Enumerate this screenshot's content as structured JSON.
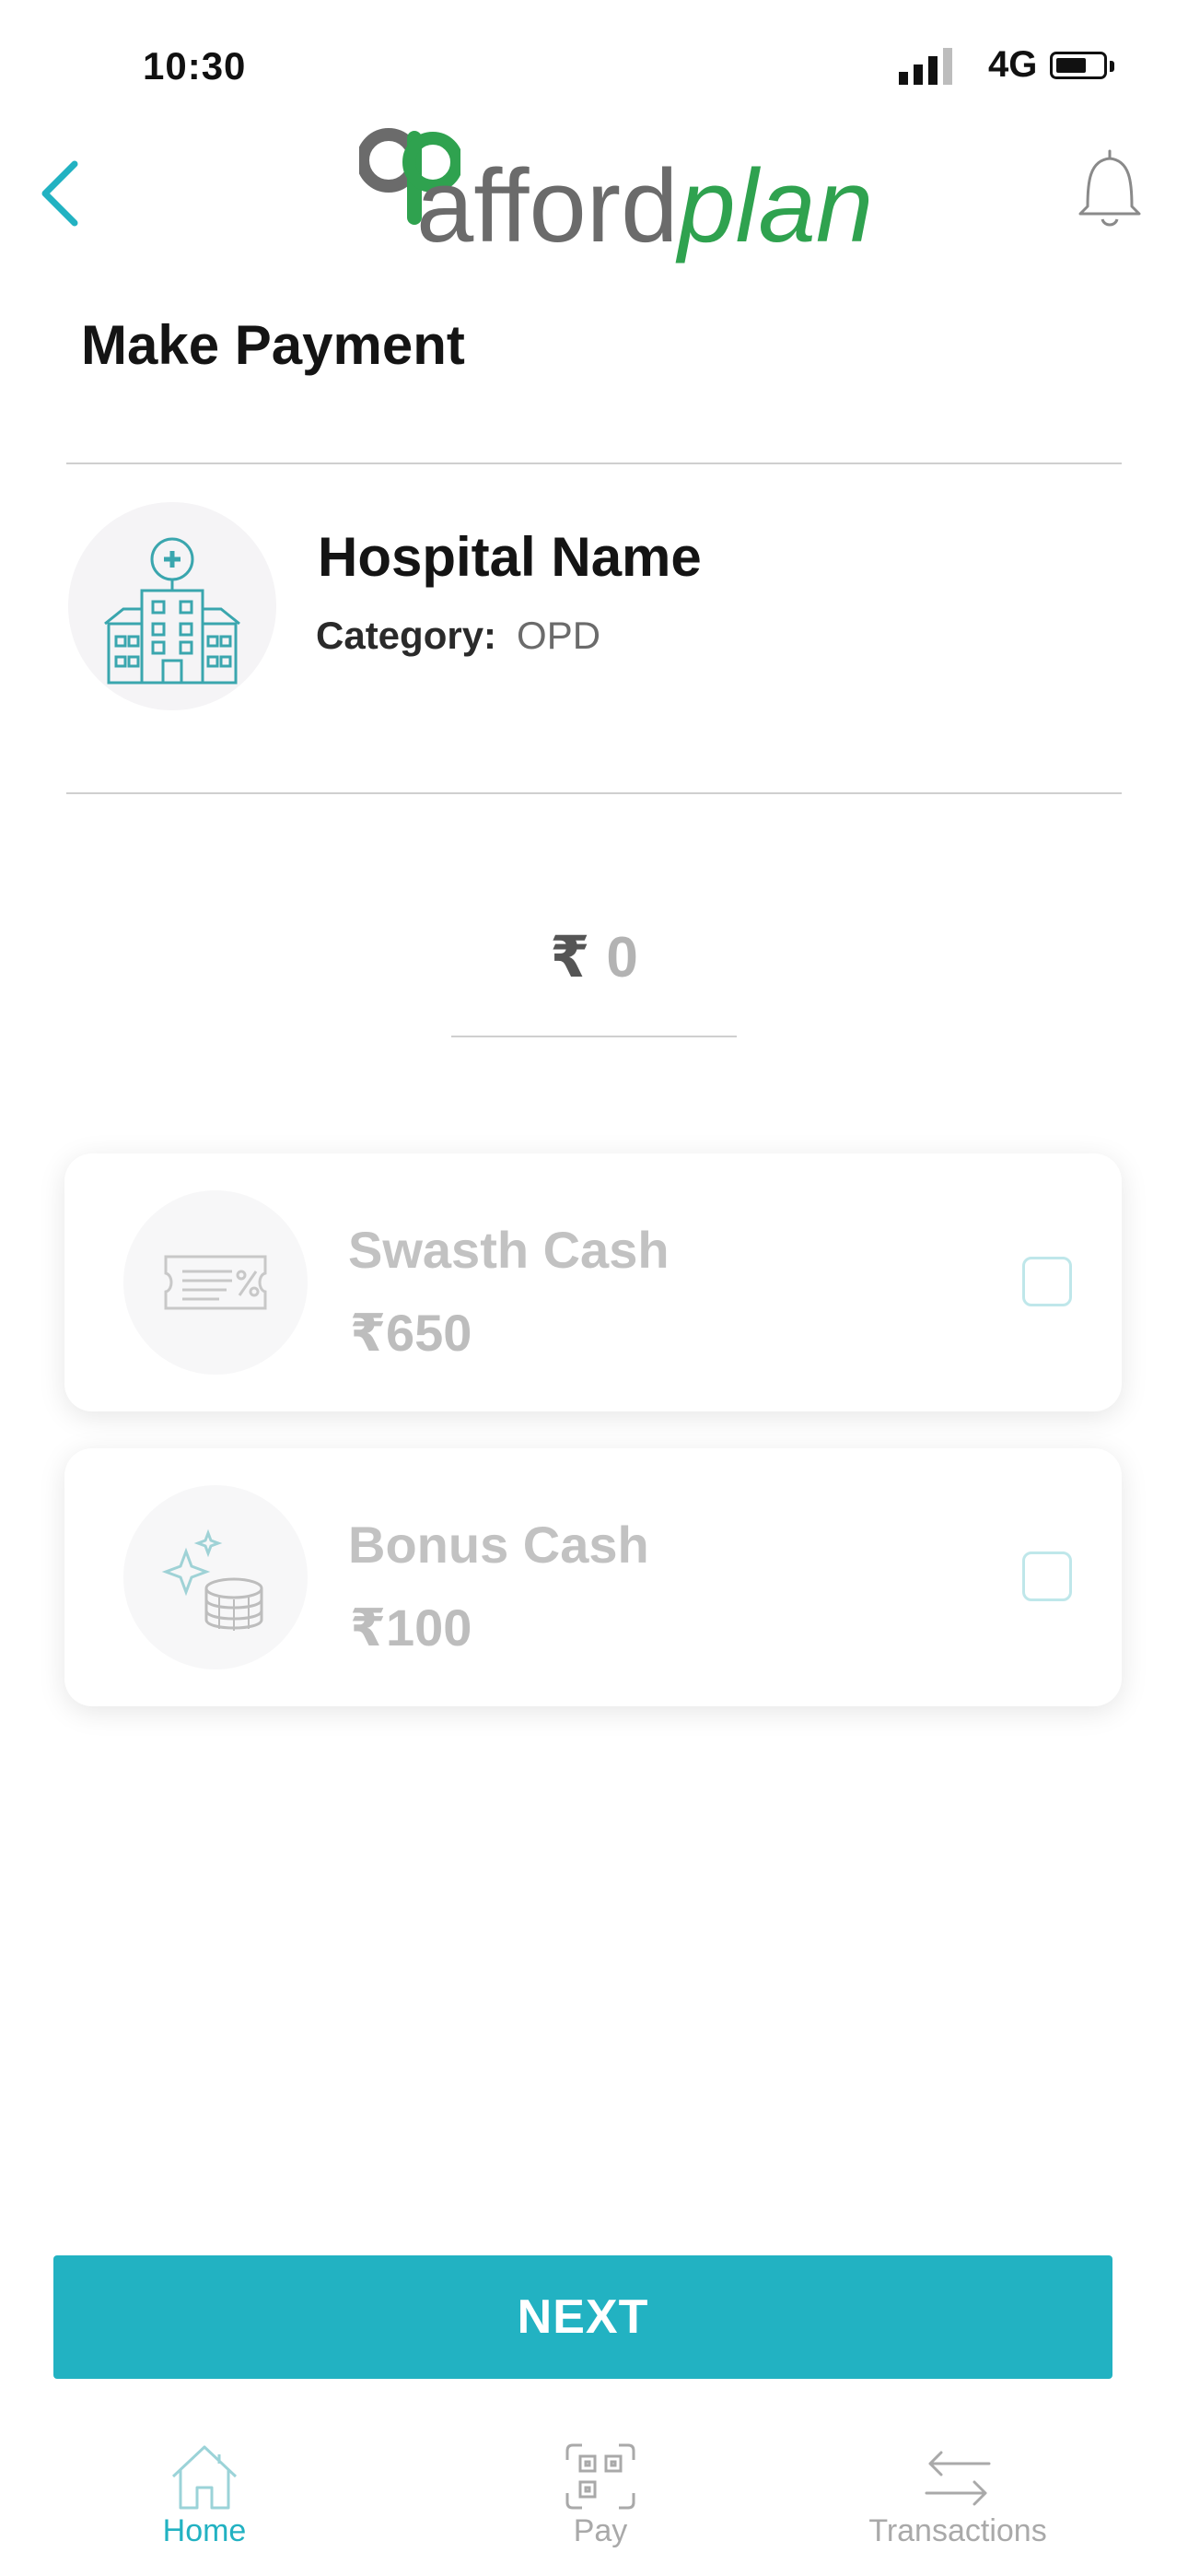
{
  "status_bar": {
    "time": "10:30",
    "network": "4G",
    "battery_level": 0.6
  },
  "header": {
    "logo_text_gray": "afford",
    "logo_text_green": "plan"
  },
  "page": {
    "title": "Make Payment"
  },
  "hospital": {
    "name": "Hospital Name",
    "category_label": "Category:",
    "category_value": "OPD"
  },
  "payment": {
    "currency_symbol": "₹",
    "amount": "0"
  },
  "wallets": [
    {
      "name": "Swasth Cash",
      "amount": "₹650",
      "checked": false
    },
    {
      "name": "Bonus Cash",
      "amount": "₹100",
      "checked": false
    }
  ],
  "next_button": {
    "label": "NEXT"
  },
  "bottom_nav": [
    {
      "label": "Home",
      "active": true
    },
    {
      "label": "Pay",
      "active": false
    },
    {
      "label": "Transactions",
      "active": false
    }
  ],
  "colors": {
    "accent": "#22b2c2",
    "brand_green": "#2fa24f",
    "brand_gray": "#6b6b6b",
    "nav_inactive": "#a9a9a9"
  },
  "icons": [
    "back-chevron-icon",
    "bell-icon",
    "hospital-icon",
    "voucher-icon",
    "coins-icon",
    "home-icon",
    "qr-pay-icon",
    "transfer-arrows-icon"
  ]
}
